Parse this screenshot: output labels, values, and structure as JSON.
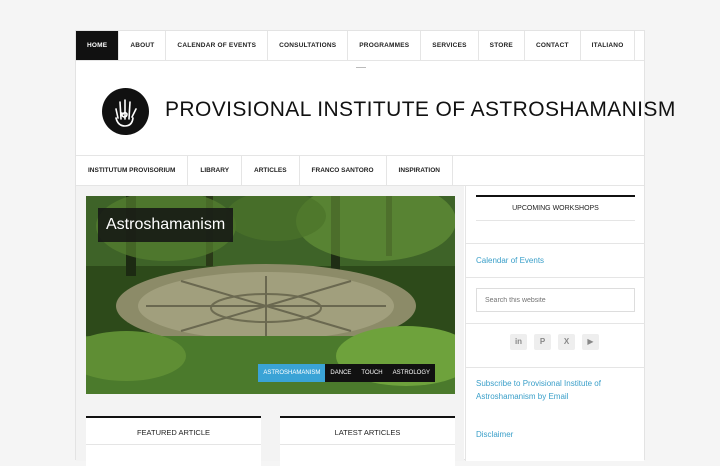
{
  "topnav": {
    "items": [
      {
        "label": "HOME",
        "active": true
      },
      {
        "label": "ABOUT"
      },
      {
        "label": "CALENDAR OF EVENTS"
      },
      {
        "label": "CONSULTATIONS"
      },
      {
        "label": "PROGRAMMES"
      },
      {
        "label": "SERVICES"
      },
      {
        "label": "STORE"
      },
      {
        "label": "CONTACT"
      },
      {
        "label": "ITALIANO"
      }
    ]
  },
  "header": {
    "title": "PROVISIONAL INSTITUTE OF ASTROSHAMANISM",
    "logo_icon": "hand-spiral-icon"
  },
  "subnav": {
    "items": [
      {
        "label": "INSTITUTUM PROVISORIUM"
      },
      {
        "label": "LIBRARY"
      },
      {
        "label": "ARTICLES"
      },
      {
        "label": "FRANCO SANTORO"
      },
      {
        "label": "INSPIRATION"
      }
    ]
  },
  "hero": {
    "title": "Astroshamanism",
    "tags": [
      {
        "label": "ASTROSHAMANISM",
        "active": true
      },
      {
        "label": "DANCE"
      },
      {
        "label": "TOUCH"
      },
      {
        "label": "ASTROLOGY"
      }
    ]
  },
  "widgets": {
    "featured": "FEATURED ARTICLE",
    "latest": "LATEST ARTICLES"
  },
  "sidebar": {
    "upcoming": "UPCOMING WORKSHOPS",
    "calendar_link": "Calendar of Events",
    "search_placeholder": "Search this website",
    "social": [
      "linkedin-icon",
      "pinterest-icon",
      "x-icon",
      "youtube-icon"
    ],
    "subscribe_link": "Subscribe to Provisional Institute of Astroshamanism by Email",
    "disclaimer_link": "Disclaimer"
  },
  "colors": {
    "accent": "#3aa3d6",
    "link": "#3a9fc9",
    "dark": "#111111"
  }
}
